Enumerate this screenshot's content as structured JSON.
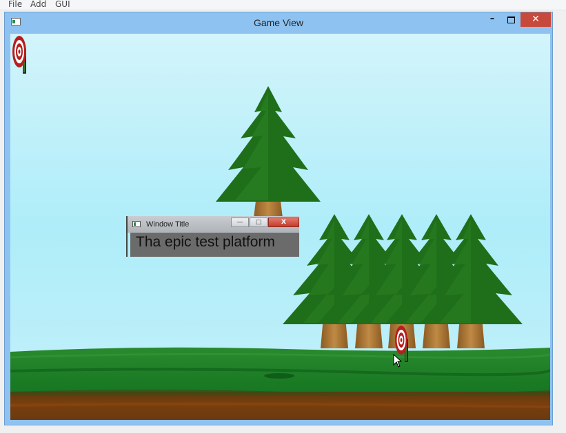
{
  "menubar": {
    "items": [
      "File",
      "Add",
      "GUI"
    ]
  },
  "window": {
    "title": "Game View",
    "controls": {
      "minimize": "–",
      "close": "✕"
    }
  },
  "scene": {
    "sky_color": "#b2eef9",
    "tree_color": "#1f6f1a",
    "trunk_color": "#b07a3a",
    "grass_color": "#1f7d28",
    "soil_color": "#6b3a10",
    "target_colors": [
      "#b51f1f",
      "#ffffff"
    ]
  },
  "subwindow": {
    "title": "Window Title",
    "text": "Tha epic test platform",
    "controls": {
      "minimize": "—",
      "maximize": "□",
      "close": "X"
    }
  }
}
